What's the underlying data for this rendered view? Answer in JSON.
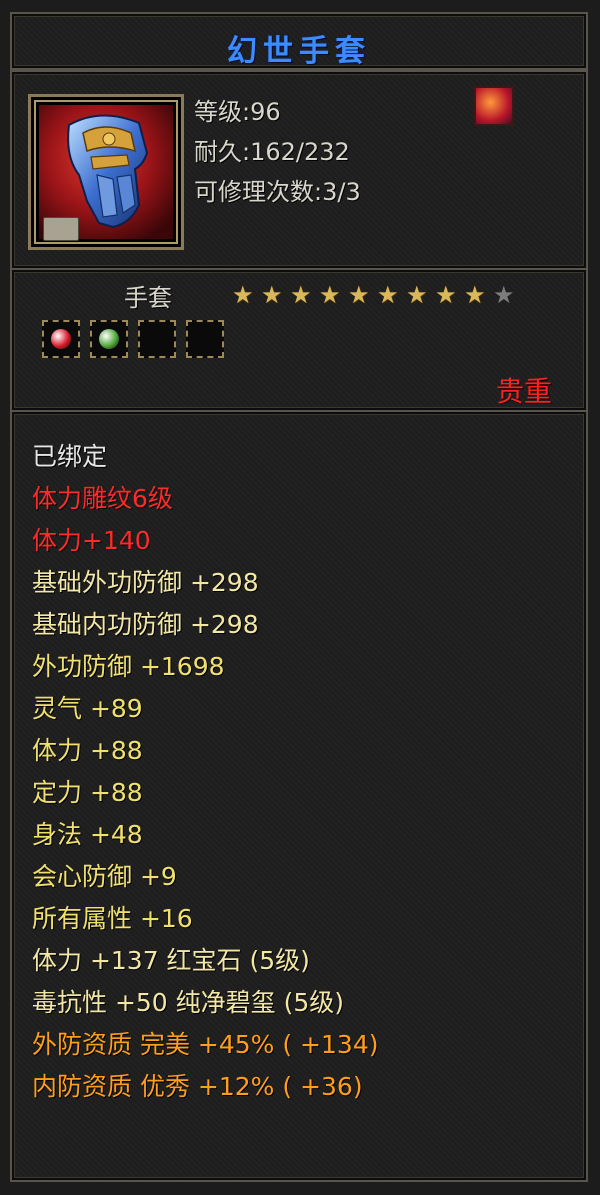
{
  "item": {
    "name": "幻世手套",
    "level_label": "等级:96",
    "durability_label": "耐久:162/232",
    "repair_label": "可修理次数:3/3",
    "type": "手套",
    "rarity": "贵重",
    "stars": {
      "filled": 9,
      "total": 10
    }
  },
  "colors": {
    "title": "#3d8cff",
    "rarity": "#ff2020",
    "bound": "#e6e6e6",
    "red_attr": "#ff2a2a",
    "yellow_attr": "#f0e070",
    "orange_attr": "#ff9e1a"
  },
  "sockets": [
    {
      "gem": "red-gem-icon",
      "color": "#d81c2c"
    },
    {
      "gem": "green-gem-icon",
      "color": "#4fa83a"
    },
    {
      "gem": "empty",
      "color": ""
    },
    {
      "gem": "empty",
      "color": ""
    }
  ],
  "attributes": [
    {
      "text": "已绑定",
      "tone": "white"
    },
    {
      "text": "体力雕纹6级",
      "tone": "red"
    },
    {
      "text": "体力+140",
      "tone": "red"
    },
    {
      "text": "基础外功防御 +298",
      "tone": "wheat"
    },
    {
      "text": "基础内功防御 +298",
      "tone": "wheat"
    },
    {
      "text": "外功防御 +1698",
      "tone": "yellow"
    },
    {
      "text": "灵气 +89",
      "tone": "yellow"
    },
    {
      "text": "体力 +88",
      "tone": "yellow"
    },
    {
      "text": "定力 +88",
      "tone": "yellow"
    },
    {
      "text": "身法 +48",
      "tone": "yellow"
    },
    {
      "text": "会心防御 +9",
      "tone": "yellow"
    },
    {
      "text": "所有属性 +16",
      "tone": "yellow"
    },
    {
      "text": "体力 +137 红宝石 (5级)",
      "tone": "wheat"
    },
    {
      "text": "毒抗性 +50 纯净碧玺 (5级)",
      "tone": "wheat"
    },
    {
      "text": "外防资质  完美 +45% ( +134)",
      "tone": "orange"
    },
    {
      "text": "内防资质  优秀 +12% ( +36)",
      "tone": "orange"
    }
  ]
}
